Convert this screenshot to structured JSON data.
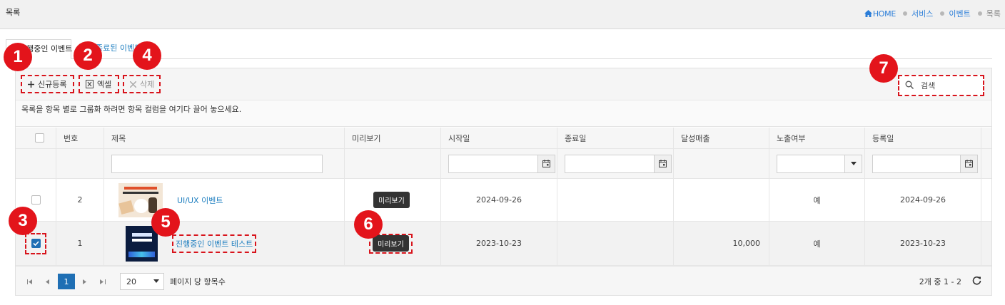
{
  "header": {
    "title": "목록",
    "breadcrumb": [
      {
        "label": "HOME",
        "kind": "home"
      },
      {
        "label": "서비스",
        "kind": "link"
      },
      {
        "label": "이벤트",
        "kind": "link"
      },
      {
        "label": "목록",
        "kind": "current"
      }
    ]
  },
  "tabs": [
    {
      "label": "진행중인 이벤트",
      "active": true
    },
    {
      "label": "종료된 이벤트",
      "active": false
    }
  ],
  "toolbar": {
    "add_label": "신규등록",
    "excel_label": "엑셀",
    "delete_label": "삭제",
    "search_placeholder": "검색"
  },
  "group_hint": "목록을 항목 별로 그룹화 하려면 항목 컬럼을 여기다 끌어 놓으세요.",
  "columns": [
    "번호",
    "제목",
    "미리보기",
    "시작일",
    "종료일",
    "달성매출",
    "노출여부",
    "등록일"
  ],
  "rows": [
    {
      "no": "2",
      "title": "UI/UX 이벤트",
      "preview": "미리보기",
      "start": "2024-09-26",
      "end": "",
      "sales": "",
      "exposed": "예",
      "registered": "2024-09-26",
      "checked": false
    },
    {
      "no": "1",
      "title": "진행중인 이벤트 테스트",
      "preview": "미리보기",
      "start": "2023-10-23",
      "end": "",
      "sales": "10,000",
      "exposed": "예",
      "registered": "2023-10-23",
      "checked": true
    }
  ],
  "pager": {
    "current_page": "1",
    "page_size": "20",
    "page_size_label": "페이지 당 항목수",
    "info": "2개 중 1 - 2"
  },
  "badges": [
    "1",
    "2",
    "3",
    "4",
    "5",
    "6",
    "7"
  ],
  "colors": {
    "accent": "#1f6fb4",
    "link": "#1f7fc0",
    "highlight": "#e3141b"
  }
}
